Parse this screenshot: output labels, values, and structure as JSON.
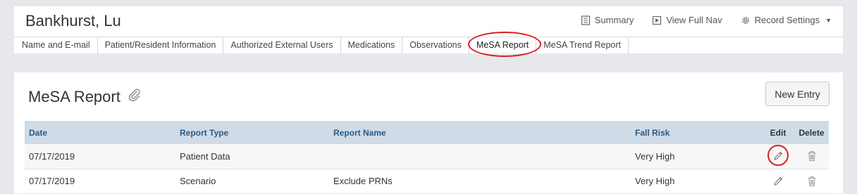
{
  "header": {
    "patient_name": "Bankhurst, Lu",
    "actions": {
      "summary": "Summary",
      "view_full_nav": "View Full Nav",
      "record_settings": "Record Settings"
    }
  },
  "tabs": [
    {
      "label": "Name and E-mail"
    },
    {
      "label": "Patient/Resident Information"
    },
    {
      "label": "Authorized External Users"
    },
    {
      "label": "Medications"
    },
    {
      "label": "Observations"
    },
    {
      "label": "MeSA Report",
      "active": true
    },
    {
      "label": "MeSA Trend Report"
    }
  ],
  "panel": {
    "title": "MeSA Report",
    "new_entry_label": "New Entry"
  },
  "table": {
    "columns": {
      "date": "Date",
      "report_type": "Report Type",
      "report_name": "Report Name",
      "fall_risk": "Fall Risk",
      "edit": "Edit",
      "delete": "Delete"
    },
    "rows": [
      {
        "date": "07/17/2019",
        "report_type": "Patient Data",
        "report_name": "",
        "fall_risk": "Very High"
      },
      {
        "date": "07/17/2019",
        "report_type": "Scenario",
        "report_name": "Exclude PRNs",
        "fall_risk": "Very High"
      }
    ]
  },
  "colors": {
    "highlight_ring": "#d81e1e",
    "table_header_bg": "#cfdbe6",
    "table_header_text": "#2c5a84"
  },
  "icons": [
    "summary-icon",
    "view-full-nav-icon",
    "gear-icon",
    "paperclip-icon",
    "pencil-icon",
    "trash-icon"
  ]
}
